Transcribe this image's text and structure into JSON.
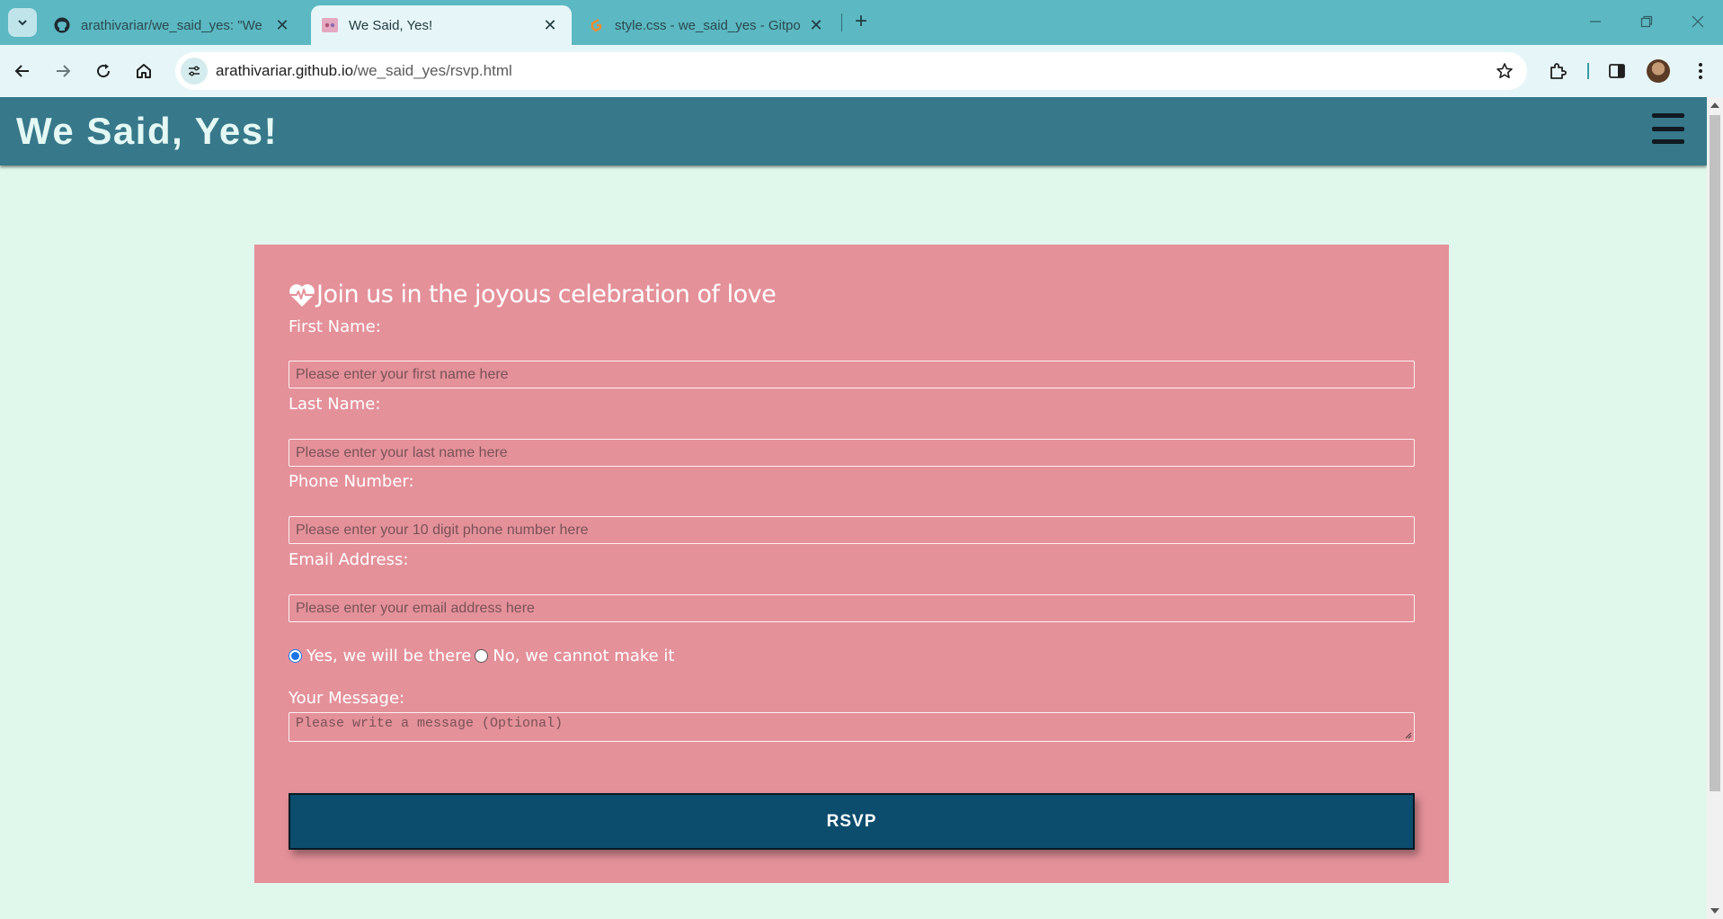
{
  "browser": {
    "tabs": [
      {
        "title": "arathivariar/we_said_yes: \"We S",
        "favicon": "github-icon",
        "active": false
      },
      {
        "title": "We Said, Yes!",
        "favicon": "site-icon",
        "active": true
      },
      {
        "title": "style.css - we_said_yes - Gitpod",
        "favicon": "gitpod-icon",
        "active": false
      }
    ],
    "url_domain": "arathivariar.github.io",
    "url_path": "/we_said_yes/rsvp.html"
  },
  "site": {
    "brand": "We Said, Yes!"
  },
  "form": {
    "heading": "Join us in the joyous celebration of love",
    "fields": [
      {
        "label": "First Name:",
        "placeholder": "Please enter your first name here"
      },
      {
        "label": "Last Name:",
        "placeholder": "Please enter your last name here"
      },
      {
        "label": "Phone Number:",
        "placeholder": "Please enter your 10 digit phone number here"
      },
      {
        "label": "Email Address:",
        "placeholder": "Please enter your email address here"
      }
    ],
    "attendance": {
      "yes_label": "Yes, we will be there",
      "no_label": "No, we cannot make it",
      "selected": "yes"
    },
    "message": {
      "label": "Your Message:",
      "placeholder": "Please write a message (Optional)"
    },
    "submit_label": "RSVP"
  },
  "colors": {
    "header": "#37788a",
    "page_bg": "#e0f8ec",
    "card_bg": "#e4919a",
    "button_bg": "#0c4c6d"
  }
}
